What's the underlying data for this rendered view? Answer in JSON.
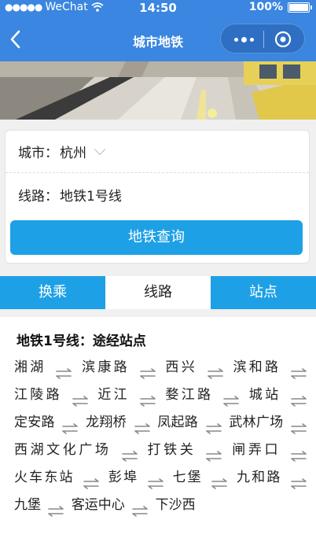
{
  "status": {
    "carrier": "WeChat",
    "time": "14:50",
    "battery": "100%"
  },
  "nav": {
    "title": "城市地铁"
  },
  "form": {
    "city_label": "城市：",
    "city_value": "杭州",
    "line_label": "线路：",
    "line_value": "地铁1号线",
    "query_button": "地铁查询"
  },
  "tabs": [
    {
      "label": "换乘"
    },
    {
      "label": "线路"
    },
    {
      "label": "站点"
    }
  ],
  "result": {
    "header": "地铁1号线：途经站点",
    "stations": [
      "湘湖",
      "滨康路",
      "西兴",
      "滨和路",
      "江陵路",
      "近江",
      "婺江路",
      "城站",
      "定安路",
      "龙翔桥",
      "凤起路",
      "武林广场",
      "西湖文化广场",
      "打铁关",
      "闸弄口",
      "火车东站",
      "彭埠",
      "七堡",
      "九和路",
      "九堡",
      "客运中心",
      "下沙西"
    ]
  },
  "icons": {
    "back": "chevron-left-icon",
    "arrow": "bidirectional-arrow-icon",
    "wifi": "wifi-icon",
    "battery": "battery-icon",
    "more": "more-icon",
    "close": "capsule-close-icon",
    "dropdown": "chevron-down-icon"
  },
  "colors": {
    "navbar": "#3a86e0",
    "accent": "#1ea0e6"
  }
}
